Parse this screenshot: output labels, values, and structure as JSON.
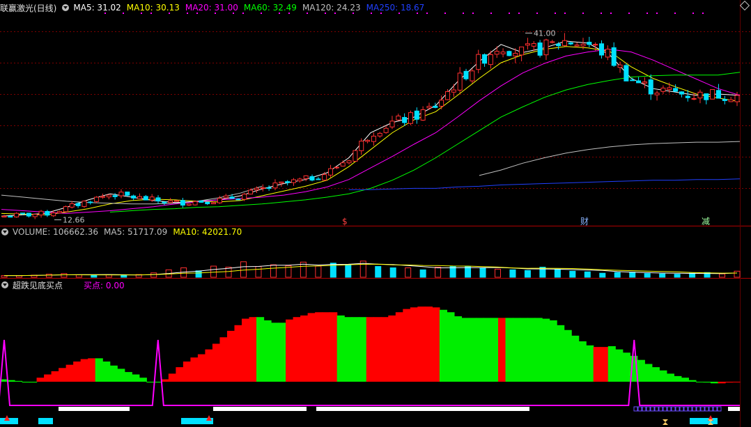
{
  "header_main": {
    "title": "联赢激光(日线)",
    "items": [
      {
        "label": "MA5: 31.02",
        "color": "#ffffff"
      },
      {
        "label": "MA10: 30.13",
        "color": "#ffff00"
      },
      {
        "label": "MA20: 31.00",
        "color": "#ff00ff"
      },
      {
        "label": "MA60: 32.49",
        "color": "#00ff00"
      },
      {
        "label": "MA120: 24.23",
        "color": "#c0c0c0"
      },
      {
        "label": "MA250: 18.67",
        "color": "#2040ff"
      }
    ]
  },
  "header_volume": {
    "items": [
      {
        "label": "VOLUME: 106662.36",
        "color": "#c0c0c0"
      },
      {
        "label": "MA5: 51717.09",
        "color": "#c0c0c0"
      },
      {
        "label": "MA10: 42021.70",
        "color": "#ffff00"
      }
    ]
  },
  "header_indicator": {
    "title": "超跌见底买点",
    "buy_label": "买点: 0.00",
    "buy_color": "#ff00ff"
  },
  "annotations": {
    "high_label": "41.00",
    "low_label": "12.66",
    "markers": [
      {
        "text": "$",
        "color": "#ff4040"
      },
      {
        "text": "财",
        "color": "#8ab4ff"
      },
      {
        "text": "减",
        "color": "#a0ffa0"
      }
    ]
  },
  "chart_data": [
    {
      "type": "candlestick",
      "name": "price",
      "y_range": [
        12,
        43
      ],
      "series": [
        {
          "name": "MA5",
          "color": "#ffffff",
          "values": [
            13.2,
            13.4,
            13.6,
            14.5,
            15.6,
            16.5,
            16.0,
            15.5,
            15.2,
            15.4,
            15.6,
            16.2,
            17.2,
            18.0,
            18.6,
            19.6,
            21.8,
            25.5,
            27.0,
            27.8,
            29.5,
            33.0,
            36.0,
            38.5,
            37.3,
            38.0,
            39.0,
            38.7,
            37.0,
            33.5,
            32.0,
            31.5,
            31.0,
            31.2,
            31.0
          ]
        },
        {
          "name": "MA10",
          "color": "#ffff00",
          "values": [
            13.6,
            13.5,
            13.4,
            13.8,
            14.3,
            15.0,
            15.5,
            15.7,
            15.6,
            15.4,
            15.3,
            15.5,
            16.2,
            16.9,
            17.6,
            18.5,
            20.5,
            23.0,
            25.5,
            27.4,
            28.6,
            31.0,
            33.5,
            35.8,
            37.0,
            37.8,
            38.2,
            38.0,
            37.5,
            35.2,
            33.5,
            32.3,
            31.2,
            30.6,
            30.1
          ]
        },
        {
          "name": "MA20",
          "color": "#ff00ff",
          "values": [
            14.2,
            14.0,
            13.8,
            13.6,
            13.8,
            14.0,
            14.3,
            14.6,
            15.0,
            15.3,
            15.6,
            15.8,
            16.0,
            16.3,
            16.8,
            17.5,
            18.6,
            20.3,
            22.0,
            23.8,
            25.5,
            27.8,
            30.2,
            32.4,
            34.3,
            35.7,
            36.8,
            37.4,
            37.8,
            37.4,
            36.2,
            34.8,
            33.4,
            32.0,
            31.0
          ]
        },
        {
          "name": "MA60",
          "color": "#00ff00",
          "values": [
            null,
            null,
            null,
            null,
            null,
            13.8,
            14.0,
            14.2,
            14.3,
            14.5,
            14.6,
            14.8,
            15.0,
            15.3,
            15.6,
            16.0,
            16.5,
            17.3,
            18.5,
            20.0,
            21.8,
            23.8,
            25.8,
            27.8,
            29.3,
            30.7,
            31.8,
            32.6,
            33.2,
            33.7,
            33.9,
            34.0,
            34.0,
            34.0,
            34.4
          ]
        },
        {
          "name": "MA120",
          "color": "#c0c0c0",
          "values": [
            16.3,
            16.0,
            15.7,
            15.4,
            15.2,
            15.1,
            15.0,
            15.0,
            15.1,
            15.4,
            15.9,
            16.6,
            17.6,
            null,
            null,
            null,
            null,
            null,
            null,
            null,
            null,
            null,
            19.2,
            20.0,
            21.0,
            21.8,
            22.5,
            23.0,
            23.4,
            23.7,
            23.9,
            24.0,
            24.1,
            24.1,
            24.2
          ]
        },
        {
          "name": "MA250",
          "color": "#2040ff",
          "values": [
            null,
            null,
            null,
            null,
            null,
            null,
            null,
            null,
            null,
            null,
            null,
            null,
            null,
            null,
            null,
            null,
            17.1,
            17.1,
            17.2,
            17.3,
            17.3,
            17.5,
            17.6,
            17.8,
            17.9,
            18.0,
            18.1,
            18.2,
            18.3,
            18.4,
            18.5,
            18.5,
            18.6,
            18.6,
            18.7
          ]
        }
      ],
      "high": 41.0,
      "low": 12.66
    },
    {
      "type": "bar",
      "name": "volume",
      "y_range": [
        0,
        120000
      ],
      "values": [
        5000,
        5000,
        6000,
        9000,
        11000,
        7000,
        6000,
        7000,
        6000,
        8000,
        13000,
        22000,
        28000,
        19000,
        33000,
        30000,
        46000,
        32000,
        37000,
        34000,
        45000,
        33000,
        42000,
        38000,
        48000,
        32000,
        28000,
        28000,
        22000,
        30000,
        33000,
        31000,
        27000,
        24000,
        22000,
        20000,
        30000,
        24000,
        18000,
        16000,
        12000,
        14000,
        15000,
        11000,
        10000,
        9000,
        12000,
        14000,
        10000,
        18000
      ],
      "up": [
        true,
        true,
        true,
        true,
        true,
        true,
        false,
        true,
        false,
        true,
        true,
        true,
        true,
        false,
        true,
        true,
        true,
        true,
        true,
        true,
        true,
        true,
        false,
        false,
        true,
        false,
        false,
        true,
        false,
        true,
        false,
        false,
        false,
        true,
        false,
        false,
        false,
        false,
        false,
        false,
        false,
        false,
        false,
        false,
        false,
        false,
        false,
        false,
        true,
        true
      ],
      "last_value": 106662.36
    },
    {
      "type": "area",
      "name": "indicator",
      "y_range": [
        -10,
        100
      ],
      "values": [
        3,
        2,
        1,
        -1,
        -1,
        5,
        9,
        13,
        17,
        21,
        25,
        28,
        29,
        29,
        25,
        20,
        16,
        12,
        9,
        5,
        -1,
        -1,
        3,
        10,
        18,
        25,
        30,
        34,
        40,
        47,
        55,
        63,
        70,
        78,
        80,
        80,
        76,
        73,
        73,
        77,
        80,
        82,
        85,
        86,
        86,
        86,
        82,
        80,
        80,
        80,
        80,
        80,
        80,
        82,
        86,
        90,
        92,
        93,
        93,
        92,
        89,
        86,
        81,
        79,
        79,
        79,
        79,
        79,
        79,
        79,
        79,
        79,
        79,
        79,
        78,
        76,
        70,
        64,
        57,
        50,
        45,
        43,
        43,
        44,
        40,
        36,
        32,
        27,
        22,
        18,
        14,
        10,
        7,
        5,
        2,
        0,
        -1,
        -2,
        -2,
        -1,
        0
      ],
      "colors": [
        "g",
        "g",
        "g",
        "g",
        "g",
        "r",
        "r",
        "r",
        "r",
        "r",
        "r",
        "r",
        "r",
        "g",
        "g",
        "g",
        "g",
        "g",
        "g",
        "g",
        "g",
        "g",
        "r",
        "r",
        "r",
        "r",
        "r",
        "r",
        "r",
        "r",
        "r",
        "r",
        "r",
        "r",
        "r",
        "g",
        "g",
        "g",
        "g",
        "r",
        "r",
        "r",
        "r",
        "r",
        "r",
        "r",
        "g",
        "g",
        "g",
        "g",
        "r",
        "r",
        "r",
        "r",
        "r",
        "r",
        "r",
        "r",
        "r",
        "r",
        "g",
        "g",
        "g",
        "g",
        "g",
        "g",
        "g",
        "g",
        "r",
        "g",
        "g",
        "g",
        "g",
        "g",
        "g",
        "g",
        "g",
        "g",
        "g",
        "g",
        "g",
        "r",
        "r",
        "g",
        "g",
        "g",
        "g",
        "g",
        "g",
        "g",
        "g",
        "g",
        "g",
        "g",
        "g",
        "g",
        "g",
        "g",
        "r",
        "r",
        "r"
      ],
      "buy_signal_peaks": [
        0,
        21,
        86
      ],
      "buy_value": 0.0
    }
  ]
}
